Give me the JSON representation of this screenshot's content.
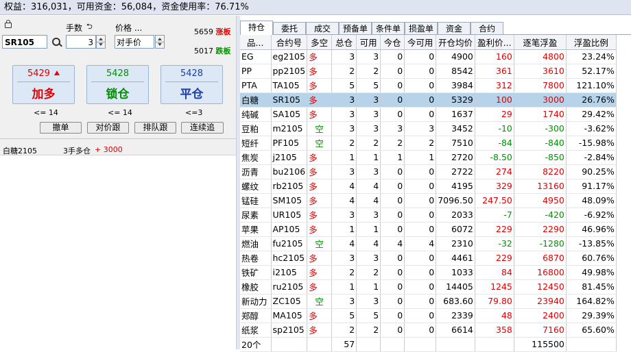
{
  "header": {
    "text": "权益：316,031，可用资金：56,084，资金使用率：76.71%"
  },
  "order": {
    "symbol": "SR105",
    "qty_label": "手数",
    "qty_value": "3",
    "price_label": "价格 ...",
    "price_type": "对手价",
    "limit_up": "5659",
    "limit_up_label": "涨板",
    "limit_down": "5017",
    "limit_down_label": "跌板",
    "buttons": [
      {
        "price": "5429",
        "action": "加多",
        "sub": "<= 14"
      },
      {
        "price": "5428",
        "action": "锁仓",
        "sub": "<= 14"
      },
      {
        "price": "5428",
        "action": "平仓",
        "sub": "<=3"
      }
    ],
    "small_buttons": [
      "撤单",
      "对价跟",
      "排队跟",
      "连续追"
    ],
    "summary_name": "白糖2105",
    "summary_pos": "3手多仓",
    "summary_pnl": "+ 3000",
    "colors": {
      "red": "#e00000",
      "green": "#009000",
      "blue": "#1a3fa8"
    }
  },
  "tabs": [
    "持仓",
    "委托",
    "成交",
    "预备单",
    "条件单",
    "损盈单",
    "资金",
    "合约"
  ],
  "table": {
    "columns": [
      "品...",
      "合约号",
      "多空",
      "总仓",
      "可用",
      "今仓",
      "今可用",
      "开仓均价",
      "盈利价...",
      "逐笔浮盈",
      "浮盈比例"
    ],
    "rows": [
      {
        "name": "EG",
        "code": "eg2105",
        "dir": "多",
        "total": "3",
        "avail": "3",
        "today": "0",
        "today_avail": "0",
        "open": "4900",
        "pnl_price": "160",
        "float_pnl": "4800",
        "ratio": "23.24%"
      },
      {
        "name": "PP",
        "code": "pp2105",
        "dir": "多",
        "total": "2",
        "avail": "2",
        "today": "0",
        "today_avail": "0",
        "open": "8542",
        "pnl_price": "361",
        "float_pnl": "3610",
        "ratio": "52.17%"
      },
      {
        "name": "PTA",
        "code": "TA105",
        "dir": "多",
        "total": "5",
        "avail": "5",
        "today": "0",
        "today_avail": "0",
        "open": "3984",
        "pnl_price": "312",
        "float_pnl": "7800",
        "ratio": "121.10%"
      },
      {
        "name": "白糖",
        "code": "SR105",
        "dir": "多",
        "total": "3",
        "avail": "3",
        "today": "0",
        "today_avail": "0",
        "open": "5329",
        "pnl_price": "100",
        "float_pnl": "3000",
        "ratio": "26.76%"
      },
      {
        "name": "纯碱",
        "code": "SA105",
        "dir": "多",
        "total": "3",
        "avail": "3",
        "today": "0",
        "today_avail": "0",
        "open": "1637",
        "pnl_price": "29",
        "float_pnl": "1740",
        "ratio": "29.42%"
      },
      {
        "name": "豆粕",
        "code": "m2105",
        "dir": "空",
        "total": "3",
        "avail": "3",
        "today": "3",
        "today_avail": "3",
        "open": "3452",
        "pnl_price": "-10",
        "float_pnl": "-300",
        "ratio": "-3.62%"
      },
      {
        "name": "短纤",
        "code": "PF105",
        "dir": "空",
        "total": "2",
        "avail": "2",
        "today": "2",
        "today_avail": "2",
        "open": "7510",
        "pnl_price": "-84",
        "float_pnl": "-840",
        "ratio": "-15.98%"
      },
      {
        "name": "焦炭",
        "code": "j2105",
        "dir": "多",
        "total": "1",
        "avail": "1",
        "today": "1",
        "today_avail": "1",
        "open": "2720",
        "pnl_price": "-8.50",
        "float_pnl": "-850",
        "ratio": "-2.84%"
      },
      {
        "name": "沥青",
        "code": "bu2106",
        "dir": "多",
        "total": "3",
        "avail": "3",
        "today": "0",
        "today_avail": "0",
        "open": "2722",
        "pnl_price": "274",
        "float_pnl": "8220",
        "ratio": "90.25%"
      },
      {
        "name": "螺纹",
        "code": "rb2105",
        "dir": "多",
        "total": "4",
        "avail": "4",
        "today": "0",
        "today_avail": "0",
        "open": "4195",
        "pnl_price": "329",
        "float_pnl": "13160",
        "ratio": "91.17%"
      },
      {
        "name": "锰硅",
        "code": "SM105",
        "dir": "多",
        "total": "4",
        "avail": "4",
        "today": "0",
        "today_avail": "0",
        "open": "7096.50",
        "pnl_price": "247.50",
        "float_pnl": "4950",
        "ratio": "48.09%"
      },
      {
        "name": "尿素",
        "code": "UR105",
        "dir": "多",
        "total": "3",
        "avail": "3",
        "today": "0",
        "today_avail": "0",
        "open": "2033",
        "pnl_price": "-7",
        "float_pnl": "-420",
        "ratio": "-6.92%"
      },
      {
        "name": "苹果",
        "code": "AP105",
        "dir": "多",
        "total": "1",
        "avail": "1",
        "today": "0",
        "today_avail": "0",
        "open": "6072",
        "pnl_price": "229",
        "float_pnl": "2290",
        "ratio": "46.96%"
      },
      {
        "name": "燃油",
        "code": "fu2105",
        "dir": "空",
        "total": "4",
        "avail": "4",
        "today": "4",
        "today_avail": "4",
        "open": "2310",
        "pnl_price": "-32",
        "float_pnl": "-1280",
        "ratio": "-13.85%"
      },
      {
        "name": "热卷",
        "code": "hc2105",
        "dir": "多",
        "total": "3",
        "avail": "3",
        "today": "0",
        "today_avail": "0",
        "open": "4461",
        "pnl_price": "229",
        "float_pnl": "6870",
        "ratio": "60.76%"
      },
      {
        "name": "铁矿",
        "code": "i2105",
        "dir": "多",
        "total": "2",
        "avail": "2",
        "today": "0",
        "today_avail": "0",
        "open": "1033",
        "pnl_price": "84",
        "float_pnl": "16800",
        "ratio": "49.98%"
      },
      {
        "name": "橡胶",
        "code": "ru2105",
        "dir": "多",
        "total": "1",
        "avail": "1",
        "today": "0",
        "today_avail": "0",
        "open": "14405",
        "pnl_price": "1245",
        "float_pnl": "12450",
        "ratio": "81.45%"
      },
      {
        "name": "新动力",
        "code": "ZC105",
        "dir": "空",
        "total": "3",
        "avail": "3",
        "today": "0",
        "today_avail": "0",
        "open": "683.60",
        "pnl_price": "79.80",
        "float_pnl": "23940",
        "ratio": "164.82%"
      },
      {
        "name": "郑醇",
        "code": "MA105",
        "dir": "多",
        "total": "5",
        "avail": "5",
        "today": "0",
        "today_avail": "0",
        "open": "2339",
        "pnl_price": "48",
        "float_pnl": "2400",
        "ratio": "29.39%"
      },
      {
        "name": "纸浆",
        "code": "sp2105",
        "dir": "多",
        "total": "2",
        "avail": "2",
        "today": "0",
        "today_avail": "0",
        "open": "6614",
        "pnl_price": "358",
        "float_pnl": "7160",
        "ratio": "65.60%"
      }
    ],
    "footer": {
      "count": "20个",
      "total": "57",
      "float_pnl": "115500"
    },
    "selected_row": 3
  }
}
